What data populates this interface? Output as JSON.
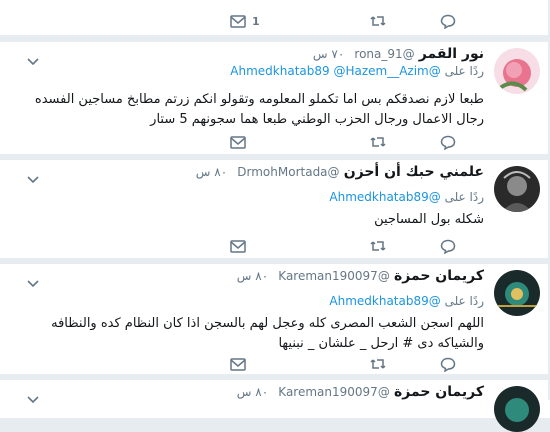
{
  "tweets": [
    {
      "partial": true,
      "body": "",
      "actions": {
        "dm_count": "1"
      }
    },
    {
      "name": "نور القمر",
      "handle": "@rona_91",
      "time": "٧٠ س",
      "reply_label": "ردًا على",
      "mentions": [
        "@Ahmedkhatab89",
        "@Hazem__Azim"
      ],
      "body_lines": [
        "طبعا لازم نصدقكم بس اما تكملو المعلومه وتقولو انكم زرتم مطابخ مساجين الفسده",
        "رجال الاعمال ورجال الحزب الوطني طبعا هما سجونهم 5 ستار"
      ]
    },
    {
      "name": "علمني حبك أن أحزن",
      "handle": "@DrmohMortada",
      "time": "٨٠ س",
      "reply_label": "ردًا على",
      "mentions": [
        "@Ahmedkhatab89"
      ],
      "body_lines": [
        "شكله بول المساجين"
      ]
    },
    {
      "name": "كريمان حمزة",
      "handle": "@Kareman190097",
      "time": "٨٠ س",
      "reply_label": "ردًا على",
      "mentions": [
        "@Ahmedkhatab89"
      ],
      "body_lines": [
        "اللهم اسجن الشعب المصرى كله وعجل لهم بالسجن  اذا كان النظام كده والنظافه",
        "والشياكه دى # ارحل _ علشان _ نبنيها"
      ]
    },
    {
      "name": "كريمان حمزة",
      "handle": "@Kareman190097",
      "time": "٨٠ س"
    }
  ],
  "colors": {
    "accent": "#1b95e0",
    "muted": "#657786",
    "bg": "#e6ecf0"
  },
  "icons": [
    "reply-icon",
    "retweet-icon",
    "like-icon",
    "dm-icon",
    "caret-icon"
  ]
}
